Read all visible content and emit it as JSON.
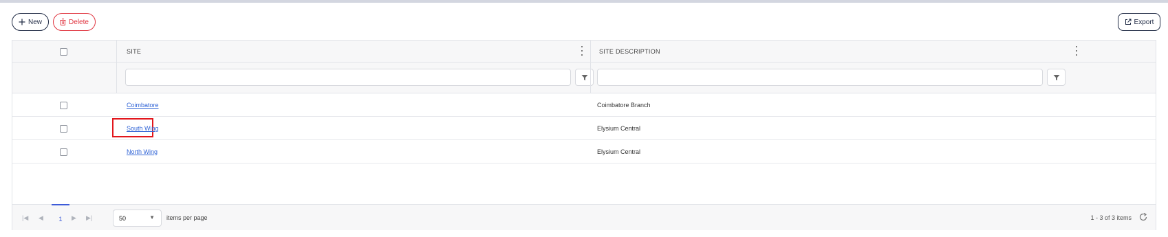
{
  "toolbar": {
    "new_label": "New",
    "delete_label": "Delete",
    "export_label": "Export",
    "new_icon": "plus-icon",
    "delete_icon": "trash-icon",
    "export_icon": "external-link-icon"
  },
  "grid": {
    "columns": [
      {
        "key": "select",
        "label": ""
      },
      {
        "key": "site",
        "label": "SITE"
      },
      {
        "key": "site_description",
        "label": "SITE DESCRIPTION"
      }
    ],
    "filters": {
      "site": {
        "value": "",
        "placeholder": ""
      },
      "site_description": {
        "value": "",
        "placeholder": ""
      }
    },
    "rows": [
      {
        "site": "Coimbatore",
        "site_description": "Coimbatore Branch",
        "highlighted": false
      },
      {
        "site": "South Wing",
        "site_description": "Elysium Central",
        "highlighted": true
      },
      {
        "site": "North Wing",
        "site_description": "Elysium Central",
        "highlighted": false
      }
    ]
  },
  "pager": {
    "current_page": "1",
    "page_size": "50",
    "page_size_label": "items per page",
    "range_info": "1 - 3 of 3 items"
  },
  "colors": {
    "link": "#2f63d6",
    "primary_border": "#1f2a44",
    "danger": "#e0343f",
    "highlight": "#e2161c",
    "active_page": "#3d5bd9"
  }
}
